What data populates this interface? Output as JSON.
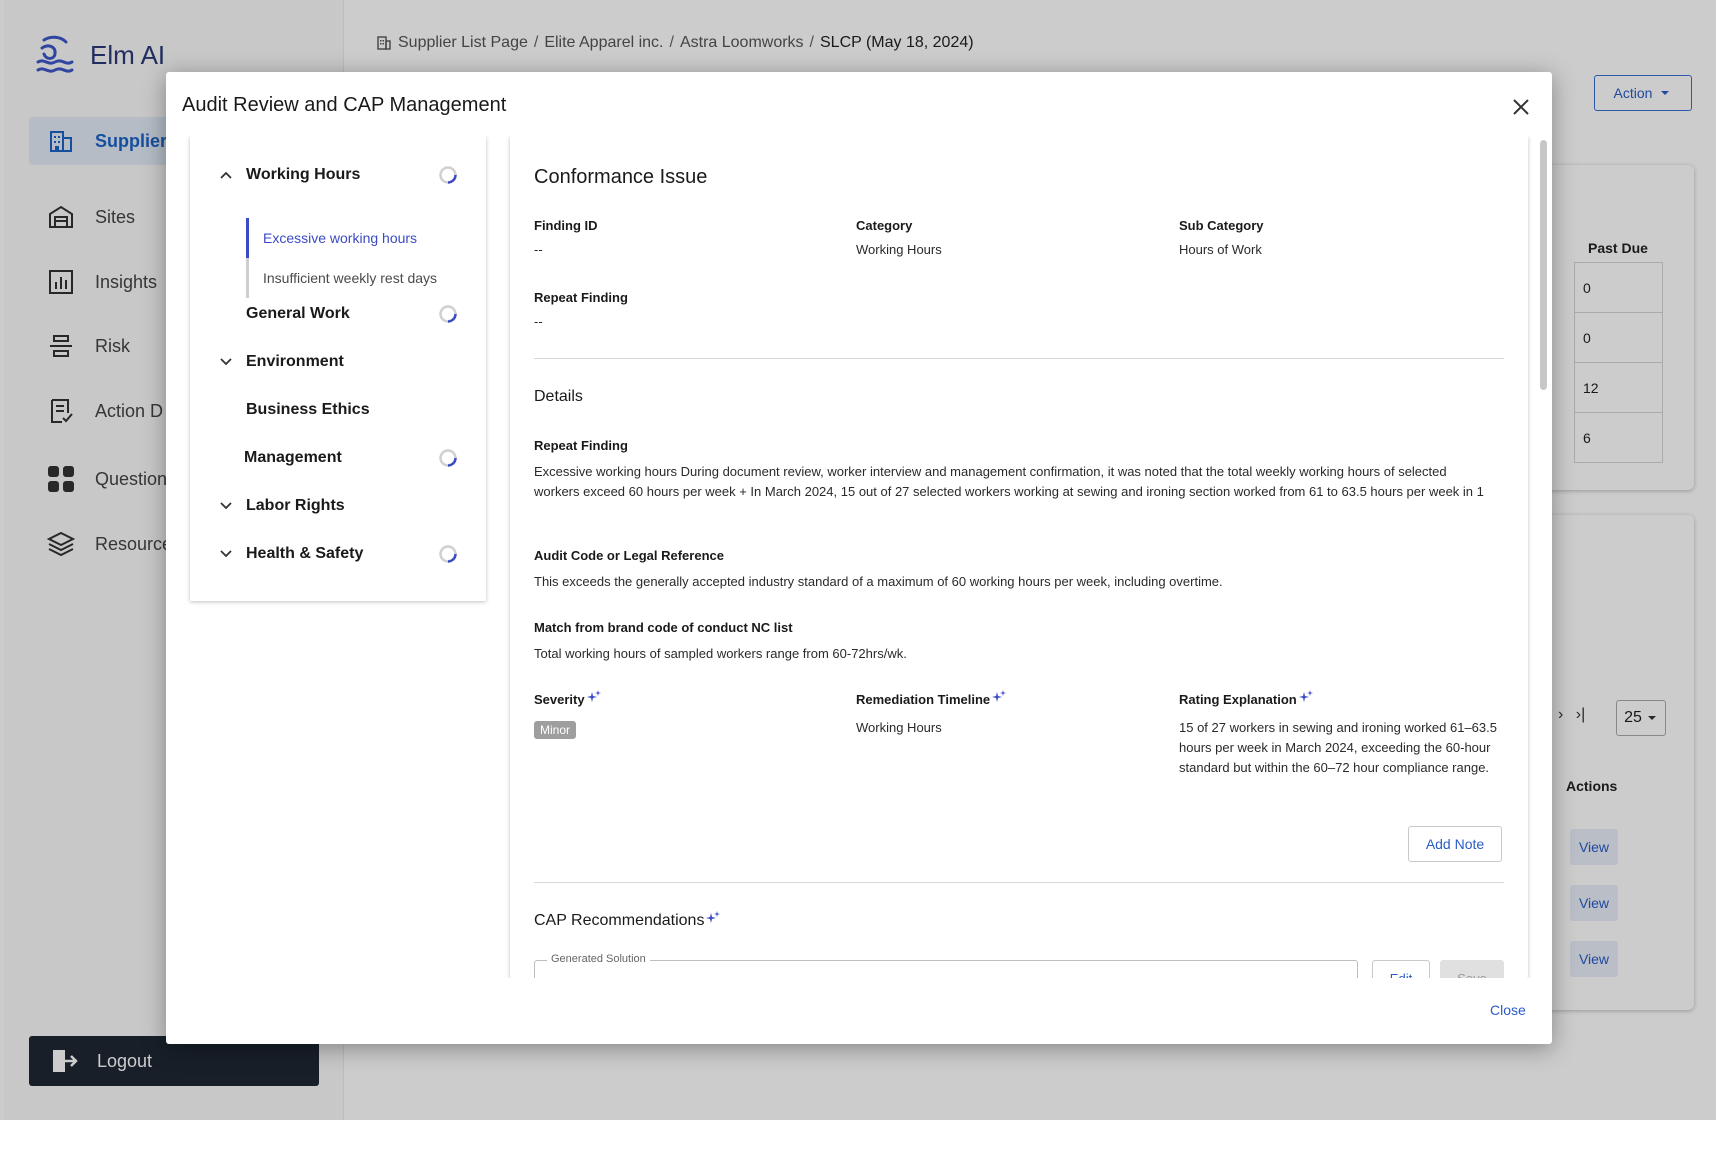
{
  "app": {
    "name": "Elm AI"
  },
  "sidebar": {
    "items": [
      {
        "label": "Supplier",
        "icon": "building-icon",
        "active": true
      },
      {
        "label": "Sites",
        "icon": "warehouse-icon"
      },
      {
        "label": "Insights",
        "icon": "chart-icon"
      },
      {
        "label": "Risk",
        "icon": "risk-icon"
      },
      {
        "label": "Action D",
        "icon": "checklist-icon"
      },
      {
        "label": "Question",
        "icon": "grid-icon"
      },
      {
        "label": "Resource",
        "icon": "layers-icon"
      }
    ],
    "logout_label": "Logout"
  },
  "breadcrumb": {
    "items": [
      "Supplier List Page",
      "Elite Apparel inc.",
      "Astra Loomworks"
    ],
    "current": "SLCP (May 18, 2024)",
    "separator": "/"
  },
  "background": {
    "action_label": "Action",
    "past_due_header": "Past Due",
    "past_due_values": [
      "0",
      "0",
      "12",
      "6"
    ],
    "actions_header": "Actions",
    "view_label": "View",
    "page_size": "25"
  },
  "modal": {
    "title": "Audit Review and CAP Management",
    "close_label": "Close",
    "tree": {
      "working_hours": "Working Hours",
      "sub_items": [
        "Excessive working hours",
        "Insufficient weekly rest days"
      ],
      "general_work": "General Work",
      "environment": "Environment",
      "business_ethics": "Business Ethics",
      "management": "Management",
      "labor_rights": "Labor Rights",
      "health_safety": "Health & Safety"
    },
    "issue": {
      "heading": "Conformance Issue",
      "finding_id_label": "Finding ID",
      "finding_id_value": "--",
      "category_label": "Category",
      "category_value": "Working Hours",
      "sub_category_label": "Sub Category",
      "sub_category_value": "Hours of Work",
      "repeat_finding_label": "Repeat Finding",
      "repeat_finding_value": "--"
    },
    "details": {
      "heading": "Details",
      "repeat_finding_label": "Repeat Finding",
      "repeat_finding_text": "Excessive working hours During document review, worker interview and management confirmation, it was noted that the total weekly working hours of selected workers exceed 60 hours per week + In March 2024, 15 out of 27 selected workers working at sewing and ironing section worked from 61 to 63.5 hours per week in 1",
      "audit_code_label": "Audit Code or Legal Reference",
      "audit_code_text": "This exceeds the generally accepted industry standard of a maximum of 60 working hours per week, including overtime.",
      "match_label": "Match from brand code of conduct NC list",
      "match_text": "Total working hours of sampled workers range from 60-72hrs/wk.",
      "severity_label": "Severity",
      "severity_value": "Minor",
      "remediation_label": "Remediation Timeline",
      "remediation_value": "Working Hours",
      "rating_label": "Rating Explanation",
      "rating_text": "15 of 27 workers in sewing and ironing worked 61–63.5 hours per week in March 2024, exceeding the 60-hour standard but within the 60–72 hour compliance range.",
      "add_note_label": "Add Note"
    },
    "cap": {
      "heading": "CAP Recommendations",
      "generated_label": "Generated Solution",
      "edit_label": "Edit",
      "save_label": "Save"
    }
  },
  "colors": {
    "accent": "#3b4bc4",
    "link": "#2a5bc7",
    "logout_bg": "#1e2733",
    "badge_minor": "#9e9e9e"
  }
}
